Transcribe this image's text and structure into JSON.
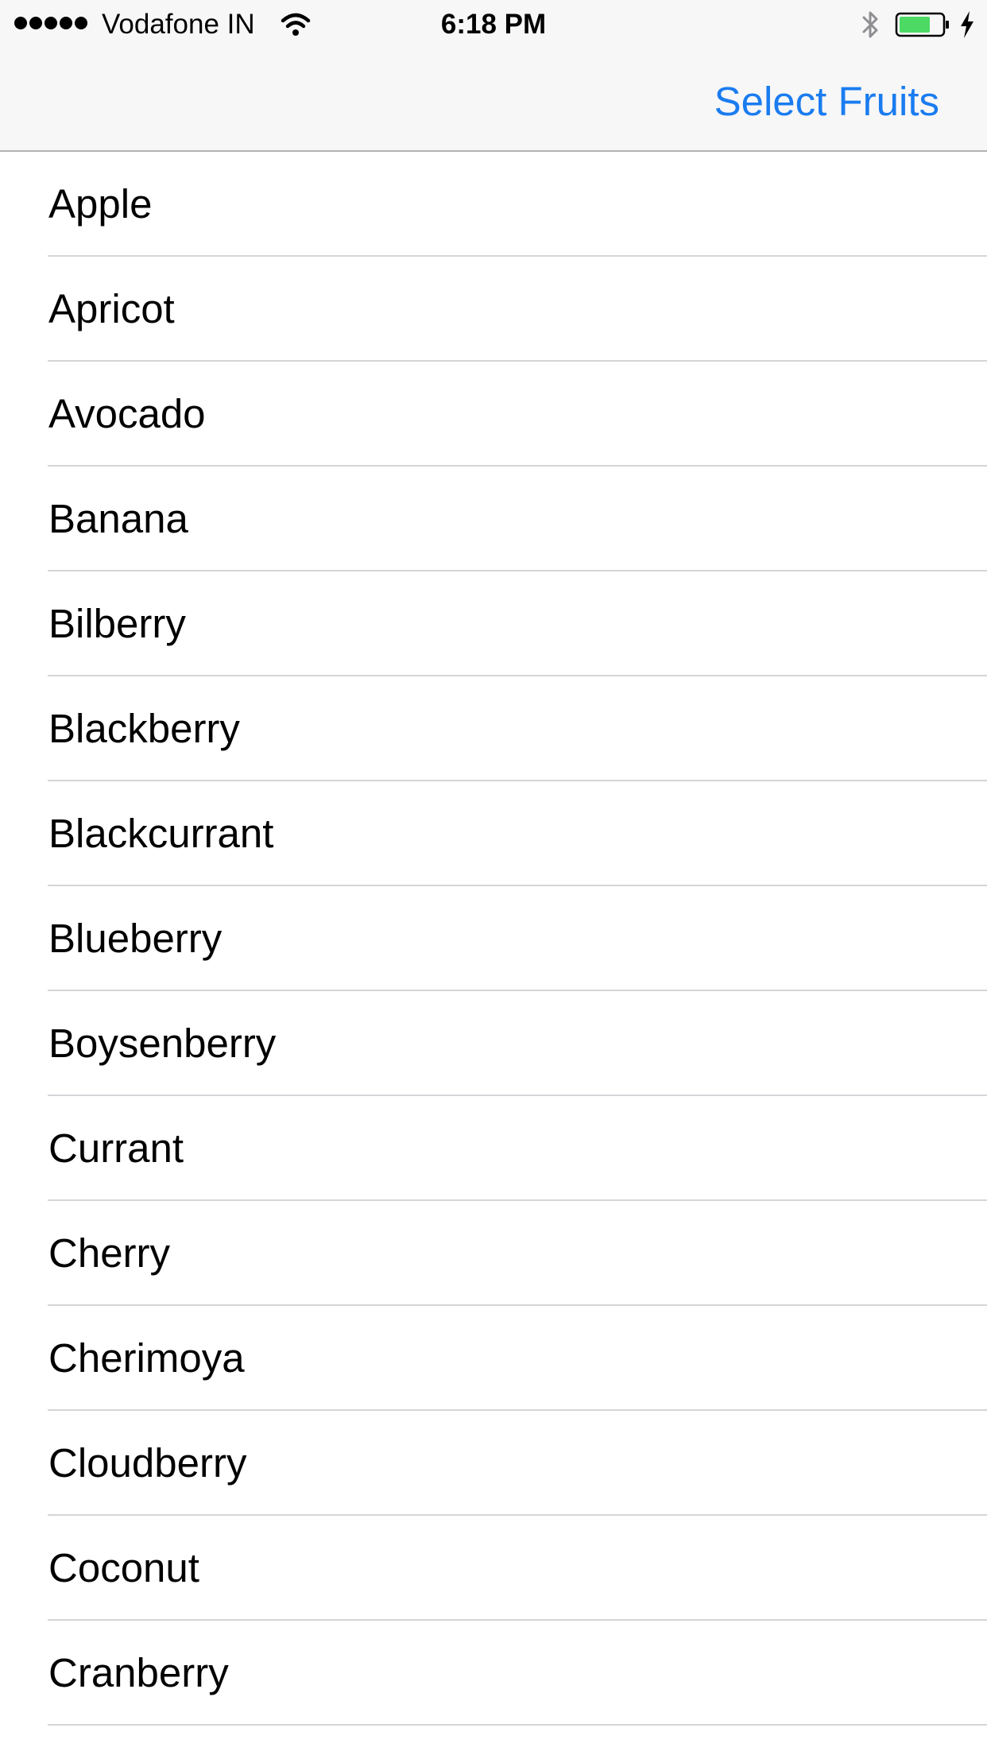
{
  "status_bar": {
    "carrier": "Vodafone IN",
    "time": "6:18 PM",
    "battery_color": "#4cd964",
    "icons": [
      "signal-dots-icon",
      "wifi-icon",
      "bluetooth-icon",
      "battery-icon",
      "charging-bolt-icon"
    ]
  },
  "nav": {
    "select_button": "Select Fruits",
    "accent_color": "#1a7cf0"
  },
  "fruits": [
    "Apple",
    "Apricot",
    "Avocado",
    "Banana",
    "Bilberry",
    "Blackberry",
    "Blackcurrant",
    "Blueberry",
    "Boysenberry",
    "Currant",
    "Cherry",
    "Cherimoya",
    "Cloudberry",
    "Coconut",
    "Cranberry"
  ]
}
